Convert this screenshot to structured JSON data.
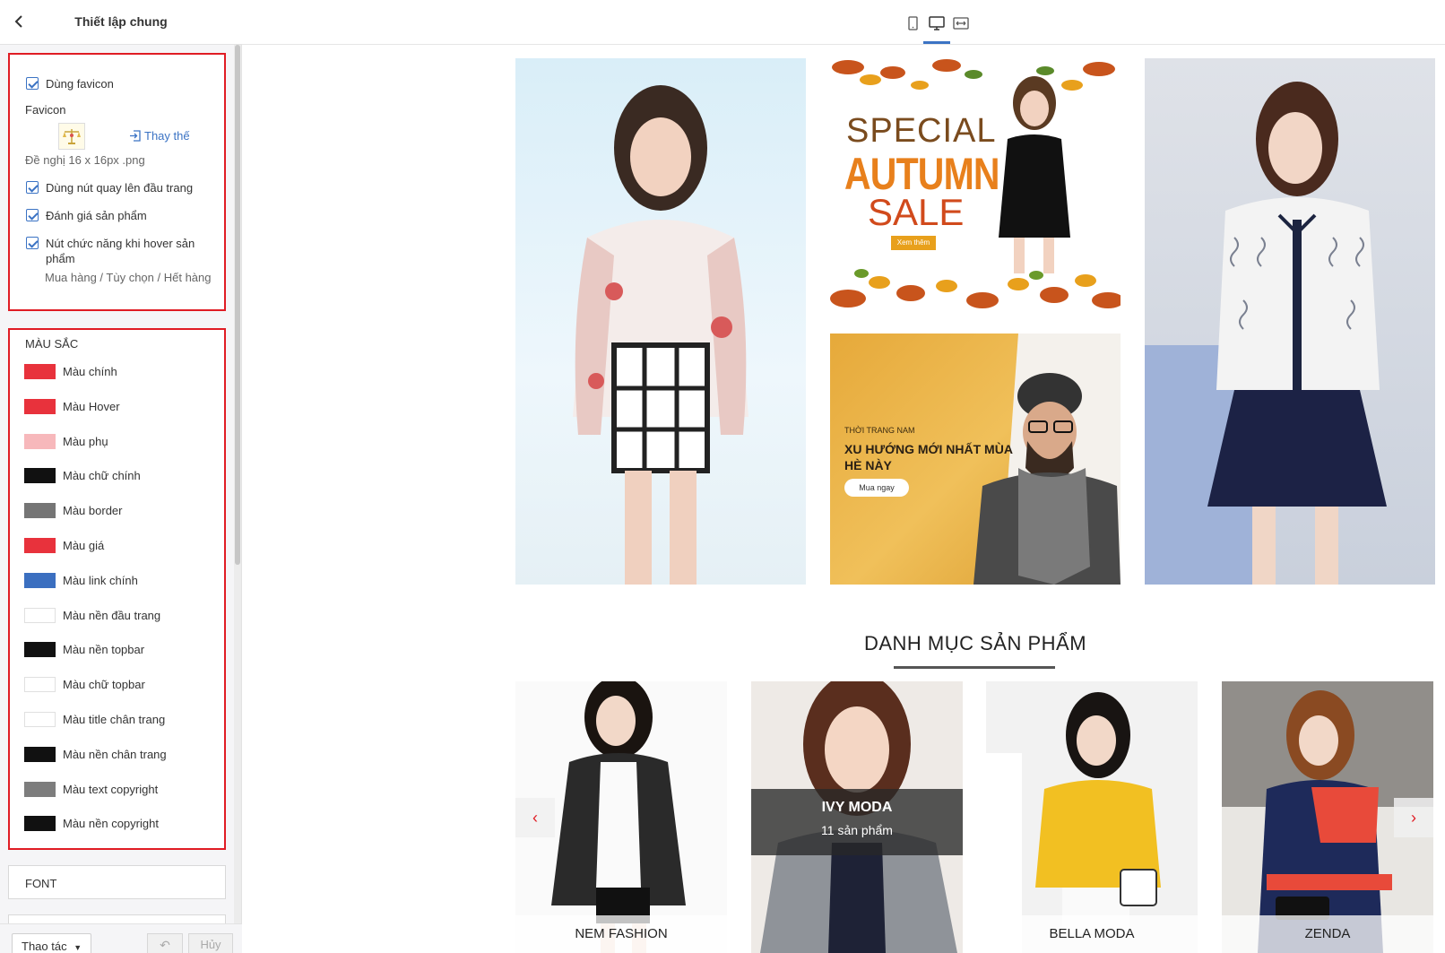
{
  "sidebar": {
    "title": "Thiết lập chung",
    "general": {
      "use_favicon": "Dùng favicon",
      "favicon_label": "Favicon",
      "replace_link": "Thay thế",
      "favicon_hint": "Đề nghị 16 x 16px .png",
      "back_to_top": "Dùng nút quay lên đầu trang",
      "product_rating": "Đánh giá sản phẩm",
      "hover_buttons": "Nút chức năng khi hover sản phẩm",
      "hover_buttons_hint": "Mua hàng / Tùy chọn / Hết hàng"
    },
    "colors": {
      "title": "MÀU SẮC",
      "items": [
        {
          "label": "Màu chính",
          "color": "#e8323c"
        },
        {
          "label": "Màu Hover",
          "color": "#e8323c"
        },
        {
          "label": "Màu phụ",
          "color": "#f7b8bb"
        },
        {
          "label": "Màu chữ chính",
          "color": "#111111"
        },
        {
          "label": "Màu border",
          "color": "#757575"
        },
        {
          "label": "Màu giá",
          "color": "#e8323c"
        },
        {
          "label": "Màu link chính",
          "color": "#3b6fc0"
        },
        {
          "label": "Màu nền đầu trang",
          "color": "#ffffff"
        },
        {
          "label": "Màu nền topbar",
          "color": "#111111"
        },
        {
          "label": "Màu chữ topbar",
          "color": "#ffffff"
        },
        {
          "label": "Màu title chân trang",
          "color": "#ffffff"
        },
        {
          "label": "Màu nền chân trang",
          "color": "#111111"
        },
        {
          "label": "Màu text copyright",
          "color": "#7d7d7d"
        },
        {
          "label": "Màu nền copyright",
          "color": "#111111"
        }
      ]
    },
    "font_section": "FONT",
    "footer": {
      "action": "Thao tác",
      "undo": "↶",
      "cancel": "Hủy"
    }
  },
  "preview": {
    "banner_autumn": {
      "line1": "SPECIAL",
      "line2": "AUTUMN",
      "line3": "SALE",
      "button": "Xem thêm"
    },
    "banner_men": {
      "small": "THỜI TRANG NAM",
      "title": "XU HƯỚNG MỚI NHẤT MÙA HÈ NÀY",
      "button": "Mua ngay"
    },
    "category_heading": "DANH MỤC SẢN PHẨM",
    "categories": [
      {
        "name": "NEM FASHION"
      },
      {
        "name": "IVY MODA",
        "count": "11 sản phẩm"
      },
      {
        "name": "BELLA MODA"
      },
      {
        "name": "ZENDA"
      }
    ],
    "arrow_left": "‹",
    "arrow_right": "›"
  }
}
